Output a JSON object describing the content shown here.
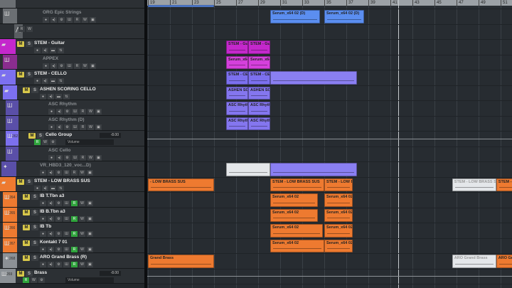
{
  "colors": {
    "blue": "#5b8ef0",
    "magenta": "#c428cc",
    "purple": "#7c70ef",
    "orange": "#ee7a30",
    "white": "#e4e7ea",
    "grey": "#8c9196"
  },
  "ruler": {
    "bars": [
      "19",
      "21",
      "23",
      "25",
      "27",
      "29",
      "31",
      "33",
      "35",
      "37",
      "39",
      "41",
      "43",
      "45",
      "47",
      "49",
      "51"
    ]
  },
  "tracks": [
    {
      "name": "",
      "color": "#6b6f73",
      "indent": 0,
      "icon": "",
      "dim": true,
      "ms": false,
      "kind": "partial"
    },
    {
      "name": "ORG Epic Strings",
      "color": "#6b6f73",
      "indent": 4,
      "icon": "Ш",
      "dim": true,
      "ms": false,
      "kind": "inst"
    },
    {
      "name": "",
      "color": "#5a5e62",
      "indent": 20,
      "icon": "⋀",
      "dim": true,
      "ms": false,
      "kind": "auto"
    },
    {
      "name": "STEM - Guitar",
      "color": "#c428cc",
      "indent": 0,
      "icon": "▰",
      "dim": false,
      "ms": true,
      "kind": "folder"
    },
    {
      "name": "APPEX",
      "color": "#8a2d8f",
      "indent": 4,
      "icon": "Ш",
      "dim": true,
      "ms": false,
      "kind": "inst"
    },
    {
      "name": "STEM - CELLO",
      "color": "#7c70ef",
      "indent": 0,
      "icon": "▰",
      "dim": false,
      "ms": true,
      "kind": "folder"
    },
    {
      "name": "ASHEN SCORING CELLO",
      "color": "#7c70ef",
      "indent": 4,
      "icon": "▰",
      "dim": false,
      "ms": true,
      "kind": "folder"
    },
    {
      "name": "ASC Rhythm",
      "color": "#5a4fa8",
      "indent": 8,
      "icon": "Ш",
      "dim": true,
      "ms": false,
      "kind": "inst"
    },
    {
      "name": "ASC Rhythm (D)",
      "color": "#5a4fa8",
      "indent": 8,
      "icon": "Ш",
      "dim": true,
      "ms": false,
      "kind": "inst"
    },
    {
      "name": "Cello Group",
      "color": "#7c70ef",
      "indent": 8,
      "icon": "Ш",
      "num": "262",
      "dim": false,
      "ms": true,
      "kind": "group",
      "volume": "-8.00",
      "param": "Volume"
    },
    {
      "name": "ASC Cello",
      "color": "#5a4fa8",
      "indent": 8,
      "icon": "Ш",
      "dim": true,
      "ms": false,
      "kind": "inst"
    },
    {
      "name": "VR_HBD3_120_voc...D)",
      "color": "#5a4fa8",
      "indent": 2,
      "icon": "✦",
      "dim": true,
      "ms": false,
      "kind": "audio"
    },
    {
      "name": "STEM - LOW BRASS SUS",
      "color": "#ee7a30",
      "indent": 0,
      "icon": "▰",
      "dim": false,
      "ms": true,
      "kind": "folder"
    },
    {
      "name": "IB T.Tbn a3",
      "color": "#ee7a30",
      "indent": 4,
      "icon": "Ш",
      "num": "264",
      "dim": false,
      "ms": true,
      "kind": "instr"
    },
    {
      "name": "IB B.Tbn a3",
      "color": "#ee7a30",
      "indent": 4,
      "icon": "Ш",
      "num": "265",
      "dim": false,
      "ms": true,
      "kind": "instr"
    },
    {
      "name": "IB Tb",
      "color": "#ee7a30",
      "indent": 4,
      "icon": "Ш",
      "num": "266",
      "dim": false,
      "ms": true,
      "kind": "instr"
    },
    {
      "name": "Kontakt 7 01",
      "color": "#ee7a30",
      "indent": 4,
      "icon": "Ш",
      "num": "267",
      "dim": false,
      "ms": true,
      "kind": "instr"
    },
    {
      "name": "ARO Grand Brass (R)",
      "color": "#8c9196",
      "indent": 4,
      "icon": "✦",
      "num": "268",
      "dim": false,
      "ms": true,
      "kind": "instr"
    },
    {
      "name": "Brass",
      "color": "#8c9196",
      "indent": 0,
      "icon": "Ш",
      "num": "269",
      "dim": false,
      "ms": true,
      "kind": "group",
      "volume": "-8.00",
      "param": "Volume"
    }
  ],
  "controls": {
    "r": "R",
    "w": "W",
    "m": "M",
    "s": "S"
  },
  "clips": [
    {
      "row": 0,
      "start": 19,
      "end": 25,
      "color": "#5b8ef0",
      "label": ""
    },
    {
      "row": 1,
      "start": 30.1,
      "end": 34.6,
      "color": "#5b8ef0",
      "label": "Serum_x64 02 (D)"
    },
    {
      "row": 1,
      "start": 35,
      "end": 38.6,
      "color": "#5b8ef0",
      "label": "Serum_x64 02 (D)"
    },
    {
      "row": 3,
      "start": 26.1,
      "end": 28.1,
      "color": "#c428cc",
      "label": "STEM - Guit"
    },
    {
      "row": 3,
      "start": 28.1,
      "end": 30.1,
      "color": "#c428cc",
      "label": "STEM - Guit"
    },
    {
      "row": 4,
      "start": 26.1,
      "end": 28.1,
      "color": "#d540dc",
      "label": "Serum_x64"
    },
    {
      "row": 4,
      "start": 28.1,
      "end": 30.1,
      "color": "#d540dc",
      "label": "Serum_x64"
    },
    {
      "row": 5,
      "start": 26.1,
      "end": 28.1,
      "color": "#7c70ef",
      "label": "STEM - CELL"
    },
    {
      "row": 5,
      "start": 28.1,
      "end": 30.1,
      "color": "#7c70ef",
      "label": "STEM - CELL"
    },
    {
      "row": 5,
      "start": 30.1,
      "end": 38,
      "color": "#8a7ff2",
      "label": ""
    },
    {
      "row": 6,
      "start": 26.1,
      "end": 28.1,
      "color": "#8476ef",
      "label": "ASHEN SCO"
    },
    {
      "row": 6,
      "start": 28.1,
      "end": 30.1,
      "color": "#8476ef",
      "label": "ASHEN SCO"
    },
    {
      "row": 7,
      "start": 26.1,
      "end": 28.1,
      "color": "#8476ef",
      "label": "ASC Rhythm"
    },
    {
      "row": 7,
      "start": 28.1,
      "end": 30.1,
      "color": "#8476ef",
      "label": "ASC Rhythm"
    },
    {
      "row": 8,
      "start": 26.1,
      "end": 28.1,
      "color": "#8476ef",
      "label": "ASC Rhythm"
    },
    {
      "row": 8,
      "start": 28.1,
      "end": 30.1,
      "color": "#8476ef",
      "label": "ASC Rhythm"
    },
    {
      "row": 11,
      "start": 26.1,
      "end": 30.1,
      "color": "#e4e7ea",
      "label": ""
    },
    {
      "row": 11,
      "start": 30.1,
      "end": 38,
      "color": "#8a7ff2",
      "label": ""
    },
    {
      "row": 12,
      "start": 19,
      "end": 25,
      "color": "#ee7a30",
      "label": "- LOW BRASS SUS"
    },
    {
      "row": 12,
      "start": 30.1,
      "end": 35,
      "color": "#ee7a30",
      "label": "STEM - LOW BRASS SUS"
    },
    {
      "row": 12,
      "start": 35,
      "end": 37.6,
      "color": "#ee7a30",
      "label": "STEM - LOW BI"
    },
    {
      "row": 12,
      "start": 46.6,
      "end": 50.6,
      "color": "#e4e7ea",
      "label": "STEM - LOW BRASS SUS"
    },
    {
      "row": 12,
      "start": 50.6,
      "end": 53,
      "color": "#ee7a30",
      "label": "STEM - LOW"
    },
    {
      "row": 13,
      "start": 30.1,
      "end": 34.4,
      "color": "#ee7a30",
      "label": "Serum_x64 02"
    },
    {
      "row": 13,
      "start": 35,
      "end": 37.6,
      "color": "#ee7a30",
      "label": "Serum_x64 02"
    },
    {
      "row": 14,
      "start": 30.1,
      "end": 34.4,
      "color": "#ee7a30",
      "label": "Serum_x64 02"
    },
    {
      "row": 14,
      "start": 35,
      "end": 37.6,
      "color": "#ee7a30",
      "label": "Serum_x64 02"
    },
    {
      "row": 15,
      "start": 30.1,
      "end": 34.9,
      "color": "#ee7a30",
      "label": "Serum_x64 02"
    },
    {
      "row": 15,
      "start": 35,
      "end": 37.6,
      "color": "#ee7a30",
      "label": "Serum_x64 02"
    },
    {
      "row": 16,
      "start": 30.1,
      "end": 35,
      "color": "#ee7a30",
      "label": "Serum_x64 02"
    },
    {
      "row": 16,
      "start": 35,
      "end": 37.6,
      "color": "#ee7a30",
      "label": "Serum_x64 02"
    },
    {
      "row": 17,
      "start": 19,
      "end": 25,
      "color": "#ee7a30",
      "label": "Grand Brass"
    },
    {
      "row": 17,
      "start": 46.6,
      "end": 50.6,
      "color": "#e4e7ea",
      "label": "ARO Grand Brass"
    },
    {
      "row": 17,
      "start": 50.6,
      "end": 53,
      "color": "#ee7a30",
      "label": "ARO Grand B"
    }
  ],
  "automation_rows": [
    9,
    18
  ]
}
